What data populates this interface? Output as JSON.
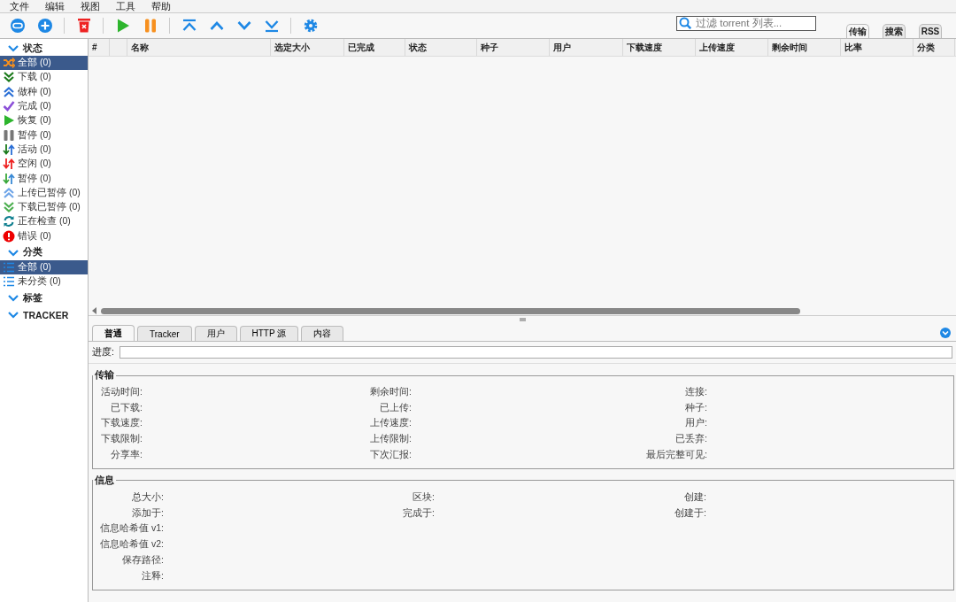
{
  "menu": [
    "文件",
    "编辑",
    "视图",
    "工具",
    "帮助"
  ],
  "search": {
    "placeholder": "过滤 torrent 列表..."
  },
  "view_tabs": [
    {
      "label": "传输",
      "selected": true
    },
    {
      "label": "搜索",
      "selected": false
    },
    {
      "label": "RSS",
      "selected": false
    }
  ],
  "sidebar": [
    {
      "title": "状态",
      "expanded": true,
      "items": [
        {
          "label": "全部 (0)",
          "selected": true
        },
        {
          "label": "下载 (0)",
          "selected": false
        },
        {
          "label": "做种 (0)",
          "selected": false
        },
        {
          "label": "完成 (0)",
          "selected": false
        },
        {
          "label": "恢复 (0)",
          "selected": false
        },
        {
          "label": "暂停 (0)",
          "selected": false
        },
        {
          "label": "活动 (0)",
          "selected": false
        },
        {
          "label": "空闲 (0)",
          "selected": false
        },
        {
          "label": "暂停 (0)",
          "selected": false
        },
        {
          "label": "上传已暂停 (0)",
          "selected": false
        },
        {
          "label": "下载已暂停 (0)",
          "selected": false
        },
        {
          "label": "正在检查 (0)",
          "selected": false
        },
        {
          "label": "错误 (0)",
          "selected": false
        }
      ]
    },
    {
      "title": "分类",
      "expanded": true,
      "items": [
        {
          "label": "全部 (0)",
          "selected": true
        },
        {
          "label": "未分类 (0)",
          "selected": false
        }
      ]
    },
    {
      "title": "标签",
      "expanded": true
    },
    {
      "title": "TRACKER",
      "expanded": true
    }
  ],
  "table": {
    "columns": [
      "#",
      "名称",
      "选定大小",
      "已完成",
      "状态",
      "种子",
      "用户",
      "下载速度",
      "上传速度",
      "剩余时间",
      "比率",
      "分类"
    ]
  },
  "detail_tabs": [
    {
      "label": "普通",
      "selected": true
    },
    {
      "label": "Tracker",
      "selected": false
    },
    {
      "label": "用户",
      "selected": false
    },
    {
      "label": "HTTP 源",
      "selected": false
    },
    {
      "label": "内容",
      "selected": false
    }
  ],
  "progress": {
    "label": "进度:",
    "level": 0
  },
  "groups": [
    {
      "title": "传输",
      "rows": [
        [
          "活动时间:",
          "剩余时间:",
          "连接:"
        ],
        [
          "已下载:",
          "已上传:",
          "种子:"
        ],
        [
          "下载速度:",
          "上传速度:",
          "用户:"
        ],
        [
          "下载限制:",
          "上传限制:",
          "已丢弃:"
        ],
        [
          "分享率:",
          "下次汇报:",
          "最后完整可见:"
        ]
      ]
    },
    {
      "title": "信息",
      "rows": [
        [
          "总大小:",
          "区块:",
          "创建:"
        ],
        [
          "添加于:",
          "完成于:",
          "创建于:"
        ],
        [
          "信息哈希值 v1:"
        ],
        [
          "信息哈希值 v2:"
        ],
        [
          "保存路径:"
        ],
        [
          "注释:"
        ]
      ]
    }
  ]
}
